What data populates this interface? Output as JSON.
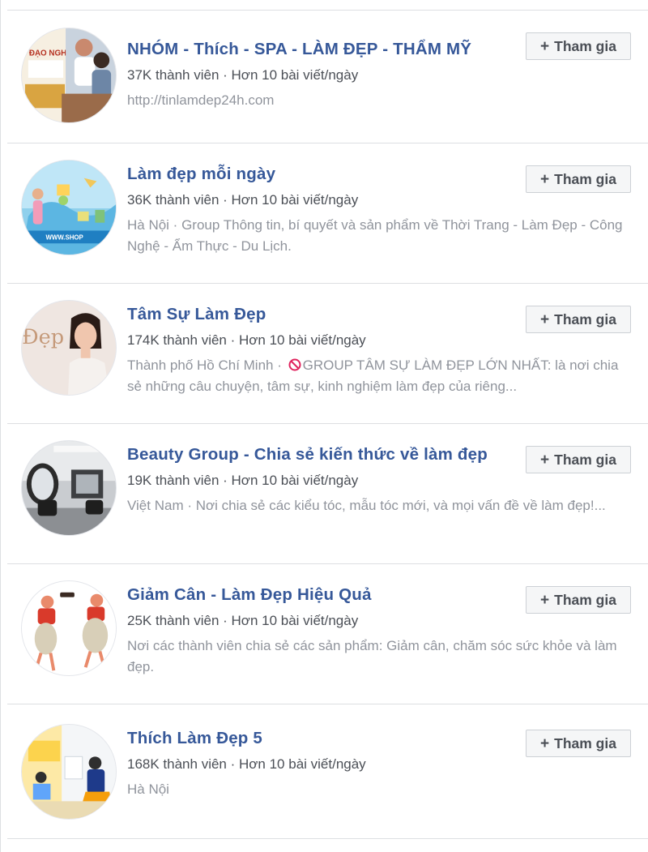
{
  "groups": [
    {
      "name": "NHÓM - Thích - SPA - LÀM ĐẸP - THẨM MỸ",
      "members": "37K thành viên",
      "activity": "Hơn 10 bài viết/ngày",
      "description": "http://tinlamdep24h.com",
      "avatar_icon": "spa-group-photo",
      "avatar_text": "ĐẠO NGHỀ"
    },
    {
      "name": "Làm đẹp mỗi ngày",
      "members": "36K thành viên",
      "activity": "Hơn 10 bài viết/ngày",
      "description": "Hà Nội · Group Thông tin, bí quyết và sản phẩm về Thời Trang - Làm Đẹp - Công Nghệ - Ẩm Thực - Du Lịch.",
      "avatar_icon": "beauty-banner-photo",
      "avatar_text": "WWW.SHOP"
    },
    {
      "name": "Tâm Sự Làm Đẹp",
      "members": "174K thành viên",
      "activity": "Hơn 10 bài viết/ngày",
      "description_prefix": "Thành phố Hồ Chí Minh · ",
      "description_rest": "GROUP TÂM SỰ LÀM ĐẸP LỚN NHẤT: là nơi chia sẻ những câu chuyện, tâm sự, kinh nghiệm làm đẹp của riêng...",
      "avatar_icon": "woman-portrait-photo",
      "avatar_text": "Đẹp"
    },
    {
      "name": "Beauty Group - Chia sẻ kiến thức về làm đẹp",
      "members": "19K thành viên",
      "activity": "Hơn 10 bài viết/ngày",
      "description": "Việt Nam · Nơi chia sẻ các kiểu tóc, mẫu tóc mới, và mọi vấn đề về làm đẹp!...",
      "avatar_icon": "salon-interior-photo"
    },
    {
      "name": "Giảm Cân - Làm Đẹp Hiệu Quả",
      "members": "25K thành viên",
      "activity": "Hơn 10 bài viết/ngày",
      "description": "Nơi các thành viên chia sẻ các sản phẩm: Giảm cân, chăm sóc sức khỏe và làm đẹp.",
      "avatar_icon": "dancing-women-illustration"
    },
    {
      "name": "Thích Làm Đẹp 5",
      "members": "168K thành viên",
      "activity": "Hơn 10 bài viết/ngày",
      "description": "Hà Nội",
      "avatar_icon": "salon-illustration"
    }
  ],
  "join_label": "Tham gia",
  "meta_separator": " · ",
  "colors": {
    "link": "#365899",
    "meta": "#4b4f56",
    "description": "#90949c",
    "divider": "#dddfe2",
    "button_bg": "#f5f6f7",
    "ban_red": "#e0245e"
  }
}
